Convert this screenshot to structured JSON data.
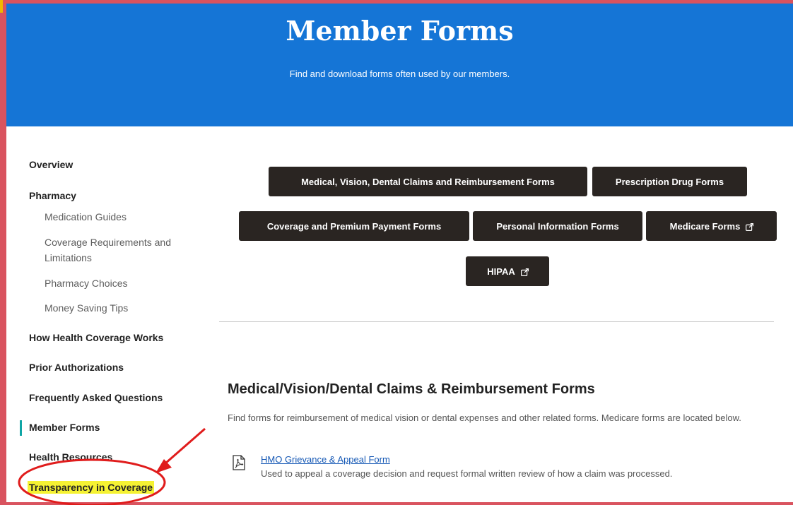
{
  "colors": {
    "hero_blue": "#1575d6",
    "button_dark": "#2a2522",
    "frame_red": "#d9535f",
    "active_teal": "#0fa5a5",
    "highlight_yellow": "#f5f233",
    "link_blue": "#1558b5"
  },
  "hero": {
    "title": "Member Forms",
    "subtitle": "Find and download forms often used by our members."
  },
  "sidebar": {
    "overview": "Overview",
    "pharmacy": "Pharmacy",
    "pharmacy_items": [
      "Medication Guides",
      "Coverage Requirements and Limitations",
      "Pharmacy Choices",
      "Money Saving Tips"
    ],
    "how_coverage_works": "How Health Coverage Works",
    "prior_authorizations": "Prior Authorizations",
    "faq": "Frequently Asked Questions",
    "member_forms": "Member Forms",
    "health_resources": "Health Resources",
    "transparency": "Transparency in Coverage",
    "active_item": "Member Forms"
  },
  "form_buttons": {
    "medical": "Medical, Vision, Dental Claims and Reimbursement Forms",
    "prescription": "Prescription Drug Forms",
    "coverage": "Coverage and Premium Payment Forms",
    "personal": "Personal Information Forms",
    "medicare": "Medicare Forms",
    "hipaa": "HIPAA"
  },
  "section": {
    "title": "Medical/Vision/Dental Claims & Reimbursement Forms",
    "description": "Find forms for reimbursement of medical vision or dental expenses and other related forms. Medicare forms are located below.",
    "forms": [
      {
        "name": "HMO Grievance & Appeal Form",
        "description": "Used to appeal a coverage decision and request formal written review of how a claim was processed.",
        "icon": "pdf-document-icon"
      }
    ]
  },
  "icons": {
    "external_link": "external-link-icon",
    "annotation_arrow": "red-arrow",
    "annotation_circle": "red-ellipse"
  }
}
